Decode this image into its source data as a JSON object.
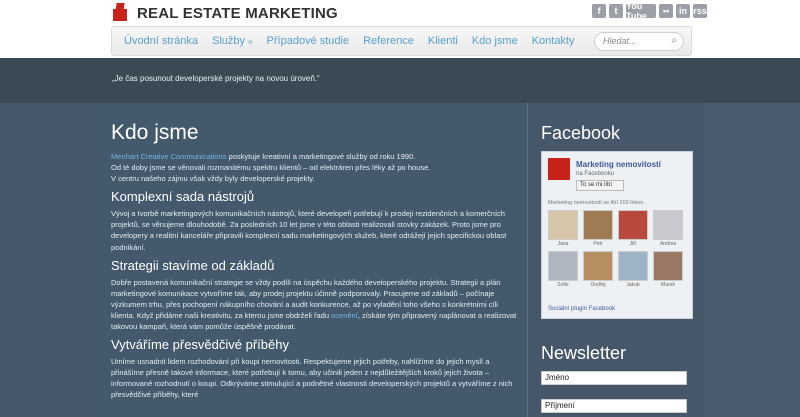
{
  "brand": {
    "name": "REAL ESTATE MARKETING"
  },
  "social": [
    "f",
    "t",
    "You Tube",
    "••",
    "in",
    "rss"
  ],
  "nav": {
    "items": [
      "Úvodní stránka",
      "Služby",
      "Případové studie",
      "Reference",
      "Klienti",
      "Kdo jsme",
      "Kontakty"
    ],
    "services_chevron": "»",
    "search_placeholder": "Hledat..."
  },
  "banner": {
    "text": "„Je čas posunout developerské projekty na novou úroveň.“"
  },
  "content": {
    "title": "Kdo jsme",
    "intro_link": "Menhart Creative Communications",
    "intro_text": " poskytuje kreativní a marketingové služby od roku 1990.",
    "intro_line2": "Od té doby jsme se věnovali rozmanitému spektru klientů – od elektráren přes léky až po house.",
    "intro_line3": "V centru našeho zájmu však vždy byly developerské projekty.",
    "s1_title": "Komplexní sada nástrojů",
    "s1_text": "Vývoj a tvorbě marketingových komunikačních nástrojů, které developeři potřebují k prodeji rezidenčních a komerčních projektů, se věnujeme dlouhodobě. Za posledních 10 let jsme v této oblasti realizovali stovky zakázek. Proto jsme pro developery a realitní kanceláře připravili komplexní sadu marketingových služeb, které odrážejí jejich specifickou oblast podnikání.",
    "s2_title": "Strategii stavíme od základů",
    "s2_text": "Dobře postavená komunikační strategie se vždy podílí na úspěchu každého developerského projektu. Strategii a plán marketingové komunikace vytvoříme tak, aby prodej projektu účinně podporovaly. Pracujeme od základů – počínaje výzkumem trhu, přes pochopení nákupního chování a audit konkurence, až po vyladění toho všeho s konkrétními cíli klienta. Když přidáme naši kreativitu, za kterou jsme obdrželi řadu ",
    "s2_link": "ocenění",
    "s2_text_end": ", získáte tým připravený naplánovat a realizovat takovou kampaň, která vám pomůže úspěšně prodávat.",
    "s3_title": "Vytváříme přesvědčivé příběhy",
    "s3_text": "Umíme usnadnit lidem rozhodování při koupi nemovitosti. Respektujeme jejich potřeby, nahlížíme do jejich myslí a přinášíme přesně takové informace, které potřebují k tomu, aby učinili jeden z nejdůležitějších kroků jejich života – informované rozhodnutí o koupi. Odkrýváme stimulující a podnětné vlastnosti developerských projektů a vytváříme z nich přesvědčivé příběhy, které"
  },
  "facebook": {
    "title": "Facebook",
    "page_name": "Marketing nemovitostí",
    "page_sub": "na Facebooku",
    "like_label": "To se mi líbí",
    "count_text": "Marketing nemovitostí se líbí 203 lidem.",
    "people": [
      {
        "name": "Jana",
        "color": "#d8c6a8"
      },
      {
        "name": "Petr",
        "color": "#a07a52"
      },
      {
        "name": "Jiří",
        "color": "#b8493c"
      },
      {
        "name": "Andrea",
        "color": "#c7c9cf"
      },
      {
        "name": "Sofie",
        "color": "#aeb7c2"
      },
      {
        "name": "Ondřej",
        "color": "#b78f63"
      },
      {
        "name": "Jakub",
        "color": "#9fb3c7"
      },
      {
        "name": "Marek",
        "color": "#9b7766"
      }
    ],
    "plugin_text": "Sociální plugin Facebook"
  },
  "newsletter": {
    "title": "Newsletter",
    "name_value": "Jméno",
    "surname_value": "Příjmení"
  }
}
